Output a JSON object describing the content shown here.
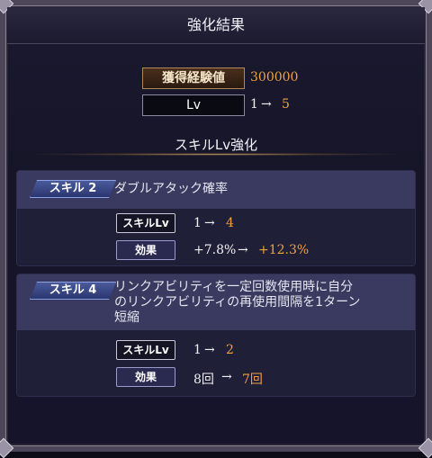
{
  "header": {
    "title": "強化結果"
  },
  "summary": {
    "exp_label": "獲得経験値",
    "exp_value": "300000",
    "lv_label": "Lv",
    "lv_from": "1",
    "lv_arrow": "→",
    "lv_to": "5"
  },
  "section_title": "スキルLv強化",
  "skills": [
    {
      "tag": "スキル 2",
      "description": "ダブルアタック確率",
      "level_label": "スキルLv",
      "level_from": "1",
      "level_to": "4",
      "effect_label": "効果",
      "effect_from": "+7.8%",
      "effect_to": "+12.3%",
      "arrow": "→"
    },
    {
      "tag": "スキル 4",
      "description_lines": [
        "リンクアビリティを一定回数使用時に自分",
        "のリンクアビリティの再使用間隔を1ターン",
        "短縮"
      ],
      "level_label": "スキルLv",
      "level_from": "1",
      "level_to": "2",
      "effect_label": "効果",
      "effect_from": "8回",
      "effect_to": "7回",
      "arrow": "→"
    }
  ]
}
